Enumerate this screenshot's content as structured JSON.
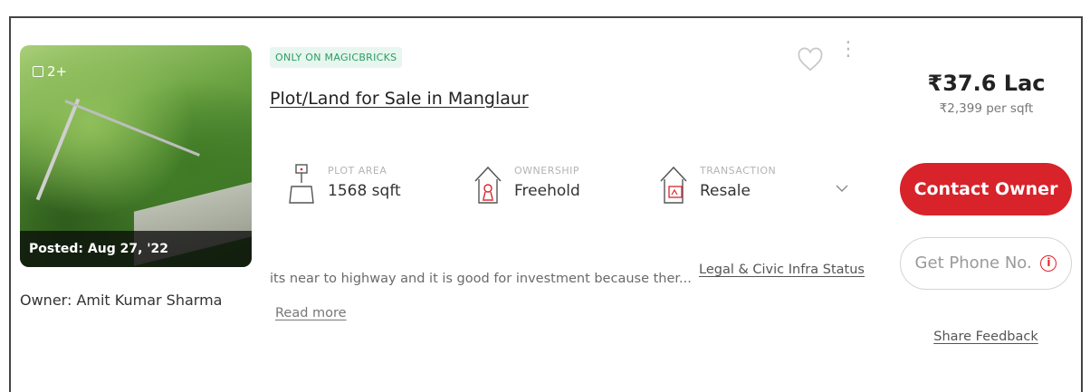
{
  "photo": {
    "count_label": "2+",
    "posted_label": "Posted: Aug 27, '22",
    "icon": "gallery-icon"
  },
  "owner_label": "Owner: Amit Kumar Sharma",
  "tag": "ONLY ON MAGICBRICKS",
  "title": "Plot/Land for Sale in Manglaur",
  "attributes": [
    {
      "label": "PLOT AREA",
      "value": "1568 sqft",
      "icon": "plot-area-icon"
    },
    {
      "label": "OWNERSHIP",
      "value": "Freehold",
      "icon": "ownership-icon"
    },
    {
      "label": "TRANSACTION",
      "value": "Resale",
      "icon": "transaction-icon"
    }
  ],
  "description": "its near to highway and it is good for investment because ther...",
  "read_more": "Read more",
  "legal_link": "Legal & Civic Infra Status",
  "price": {
    "total": "₹37.6 Lac",
    "per_sqft": "₹2,399 per sqft"
  },
  "actions": {
    "contact_owner": "Contact Owner",
    "get_phone": "Get Phone No.",
    "share_feedback": "Share Feedback"
  },
  "colors": {
    "brand_red": "#d8232a",
    "tag_green": "#2a9d62",
    "tag_bg": "#e7f6ee"
  }
}
